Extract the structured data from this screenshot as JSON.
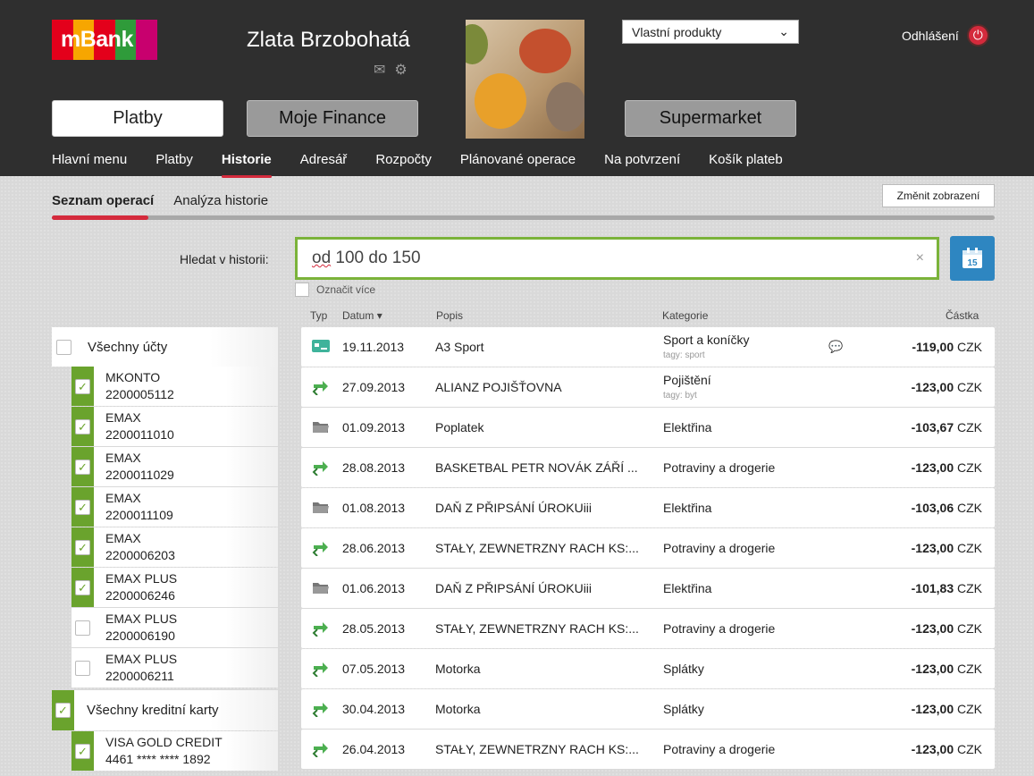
{
  "header": {
    "logo_text": "mBank",
    "user_name": "Zlata Brzobohatá",
    "user_icons": [
      "mail-icon",
      "gear-icon"
    ],
    "products_select": "Vlastní produkty",
    "logout_label": "Odhlášení",
    "big_buttons": [
      "Platby",
      "Moje Finance",
      "Supermarket"
    ],
    "nav": [
      "Hlavní menu",
      "Platby",
      "Historie",
      "Adresář",
      "Rozpočty",
      "Plánované operace",
      "Na potvrzení",
      "Košík plateb"
    ],
    "nav_active": "Historie",
    "brand_colors": [
      "#e3001b",
      "#f7a600",
      "#e3001b",
      "#2f9b3a",
      "#c8006e"
    ]
  },
  "subtabs": {
    "items": [
      "Seznam operací",
      "Analýza historie"
    ],
    "active": "Seznam operací",
    "change_view": "Změnit zobrazení"
  },
  "search": {
    "label": "Hledat v historii:",
    "value_first": "od",
    "value_rest": " 100 do 150",
    "clear": "×",
    "calendar_day": "15",
    "mark_more": "Označit více"
  },
  "table": {
    "headers": {
      "type": "Typ",
      "date": "Datum",
      "desc": "Popis",
      "category": "Kategorie",
      "amount": "Částka"
    },
    "rows": [
      {
        "type": "card-icon",
        "date": "19.11.2013",
        "desc": "A3 Sport",
        "category": "Sport a koníčky",
        "tag": "tagy: sport",
        "comment": true,
        "amount": "-119,00",
        "currency": "CZK"
      },
      {
        "type": "transfer-icon",
        "date": "27.09.2013",
        "desc": "ALIANZ POJIŠŤOVNA",
        "category": "Pojištění",
        "tag": "tagy: byt",
        "comment": false,
        "amount": "-123,00",
        "currency": "CZK"
      },
      {
        "type": "folder-icon",
        "date": "01.09.2013",
        "desc": "Poplatek",
        "category": "Elektřina",
        "tag": "",
        "comment": false,
        "amount": "-103,67",
        "currency": "CZK"
      },
      {
        "type": "transfer-icon",
        "date": "28.08.2013",
        "desc": "BASKETBAL PETR NOVÁK ZÁŘÍ ...",
        "category": "Potraviny a drogerie",
        "tag": "",
        "comment": false,
        "amount": "-123,00",
        "currency": "CZK"
      },
      {
        "type": "folder-icon",
        "date": "01.08.2013",
        "desc": "DAŇ Z PŘIPSÁNÍ ÚROKUiii",
        "category": "Elektřina",
        "tag": "",
        "comment": false,
        "amount": "-103,06",
        "currency": "CZK"
      },
      {
        "type": "transfer-icon",
        "date": "28.06.2013",
        "desc": "STAŁY, ZEWNETRZNY RACH KS:...",
        "category": "Potraviny a drogerie",
        "tag": "",
        "comment": false,
        "amount": "-123,00",
        "currency": "CZK"
      },
      {
        "type": "folder-icon",
        "date": "01.06.2013",
        "desc": "DAŇ Z PŘIPSÁNÍ ÚROKUiii",
        "category": "Elektřina",
        "tag": "",
        "comment": false,
        "amount": "-101,83",
        "currency": "CZK"
      },
      {
        "type": "transfer-icon",
        "date": "28.05.2013",
        "desc": "STAŁY, ZEWNETRZNY RACH KS:...",
        "category": "Potraviny a drogerie",
        "tag": "",
        "comment": false,
        "amount": "-123,00",
        "currency": "CZK"
      },
      {
        "type": "transfer-icon",
        "date": "07.05.2013",
        "desc": "Motorka",
        "category": "Splátky",
        "tag": "",
        "comment": false,
        "amount": "-123,00",
        "currency": "CZK"
      },
      {
        "type": "transfer-icon",
        "date": "30.04.2013",
        "desc": "Motorka",
        "category": "Splátky",
        "tag": "",
        "comment": false,
        "amount": "-123,00",
        "currency": "CZK"
      },
      {
        "type": "transfer-icon",
        "date": "26.04.2013",
        "desc": "STAŁY, ZEWNETRZNY RACH KS:...",
        "category": "Potraviny a drogerie",
        "tag": "",
        "comment": false,
        "amount": "-123,00",
        "currency": "CZK"
      }
    ]
  },
  "accounts": {
    "all_label": "Všechny účty",
    "items": [
      {
        "name": "MKONTO",
        "number": "2200005112",
        "checked": true
      },
      {
        "name": "EMAX",
        "number": "2200011010",
        "checked": true
      },
      {
        "name": "EMAX",
        "number": "2200011029",
        "checked": true
      },
      {
        "name": "EMAX",
        "number": "2200011109",
        "checked": true
      },
      {
        "name": "EMAX",
        "number": "2200006203",
        "checked": true
      },
      {
        "name": "EMAX PLUS",
        "number": "2200006246",
        "checked": true
      },
      {
        "name": "EMAX PLUS",
        "number": "2200006190",
        "checked": false
      },
      {
        "name": "EMAX PLUS",
        "number": "2200006211",
        "checked": false
      }
    ],
    "cards_label": "Všechny kreditní karty",
    "cards": [
      {
        "name": "VISA GOLD CREDIT",
        "number": "4461 **** **** 1892",
        "checked": true
      }
    ]
  },
  "colors": {
    "accent_red": "#d42a3c",
    "green": "#6aa32d",
    "blue": "#2e86c1"
  }
}
